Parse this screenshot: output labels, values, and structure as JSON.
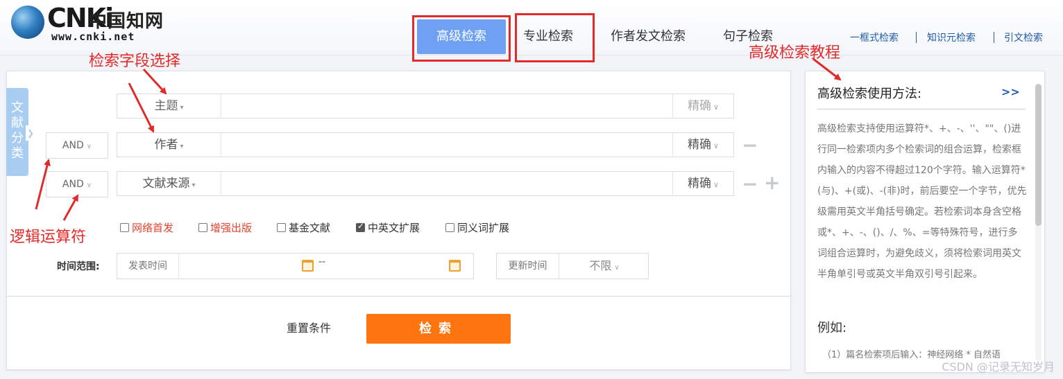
{
  "logo": {
    "brand_mark": "CNKi",
    "cn_name": "中国知网",
    "url_text": "www.cnki.net"
  },
  "modes": [
    {
      "label": "高级检索",
      "active": true
    },
    {
      "label": "专业检索",
      "active": false
    },
    {
      "label": "作者发文检索",
      "active": false
    },
    {
      "label": "句子检索",
      "active": false
    }
  ],
  "quick_links": [
    "一框式检索",
    "知识元检索",
    "引文检索"
  ],
  "annotations": {
    "field_select": "检索字段选择",
    "logic_operator": "逻辑运算符",
    "tutorial": "高级检索教程"
  },
  "side_tab": {
    "chars": [
      "文",
      "献",
      "分",
      "类"
    ]
  },
  "search_rows": [
    {
      "logic": "",
      "field": "主题",
      "value": "",
      "match": "精确"
    },
    {
      "logic": "AND",
      "field": "作者",
      "value": "",
      "match": "精确"
    },
    {
      "logic": "AND",
      "field": "文献来源",
      "value": "",
      "match": "精确"
    }
  ],
  "row_controls": {
    "minus": "−",
    "plus": "+"
  },
  "options": [
    {
      "label": "网络首发",
      "checked": false,
      "highlight": true
    },
    {
      "label": "增强出版",
      "checked": false,
      "highlight": true
    },
    {
      "label": "基金文献",
      "checked": false,
      "highlight": false
    },
    {
      "label": "中英文扩展",
      "checked": true,
      "highlight": false
    },
    {
      "label": "同义词扩展",
      "checked": false,
      "highlight": false
    }
  ],
  "time": {
    "label": "时间范围:",
    "publish_label": "发表时间",
    "range_sep": "--",
    "update_label": "更新时间",
    "update_value": "不限"
  },
  "buttons": {
    "reset": "重置条件",
    "search": "检索"
  },
  "help": {
    "title": "高级检索使用方法:",
    "more": ">>",
    "body": "高级检索支持使用运算符*、+、-、''、\"\"、()进行同一检索项内多个检索词的组合运算，检索框内输入的内容不得超过120个字符。输入运算符*(与)、+(或)、-(非)时，前后要空一个字节，优先级需用英文半角括号确定。若检索词本身含空格或*、+、-、()、/、%、=等特殊符号，进行多词组合运算时，为避免歧义，须将检索词用英文半角单引号或英文半角双引号引起来。",
    "example_title": "例如:",
    "example_1": "（1）篇名检索项后输入：神经网络 * 自然语"
  },
  "watermark": "CSDN @记录无知岁月",
  "colors": {
    "accent_blue": "#6ea1f3",
    "search_orange": "#fe7510",
    "annotation_red": "#e12b2b"
  }
}
